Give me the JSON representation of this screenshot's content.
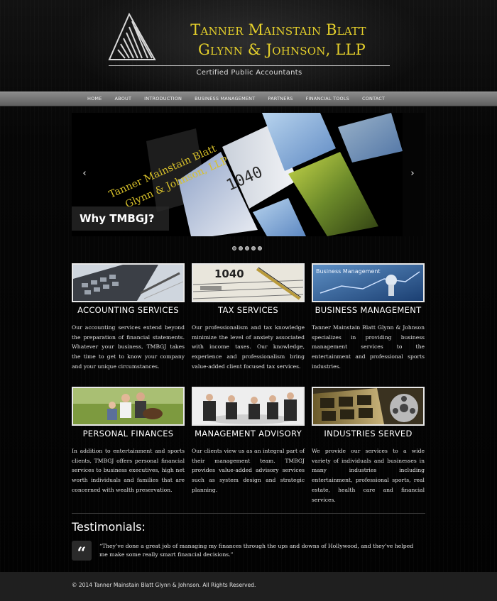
{
  "header": {
    "firm_name_line1": "Tanner Mainstain Blatt",
    "firm_name_line2": "Glynn & Johnson, LLP",
    "tagline": "Certified Public Accountants"
  },
  "nav": {
    "items": [
      "HOME",
      "ABOUT",
      "INTRODUCTION",
      "BUSINESS MANAGEMENT",
      "PARTNERS",
      "FINANCIAL TOOLS",
      "CONTACT"
    ]
  },
  "slider": {
    "caption": "Why TMBGJ?",
    "overlay_line1": "Tanner Mainstain Blatt",
    "overlay_line2": "Glynn & Johnson, LLP",
    "prev_icon": "‹",
    "next_icon": "›",
    "dot_count": 5,
    "active_dot": 0
  },
  "services": [
    {
      "title": "ACCOUNTING SERVICES",
      "text": "Our accounting services extend beyond the preparation of financial statements. Whatever your business, TMBGJ takes the time to get to know your company and your unique circumstances.",
      "image": "calculator-photo"
    },
    {
      "title": "TAX SERVICES",
      "text": "Our professionalism and tax knowledge minimize the level of anxiety associated with income taxes. Our knowledge, experience and professionalism bring value-added client focused tax services.",
      "image": "tax-form-photo",
      "image_text": "1040"
    },
    {
      "title": "BUSINESS MANAGEMENT",
      "text": "Tanner Mainstain Blatt Glynn & Johnson specializes in providing business management services to the entertainment and professional sports industries.",
      "image": "business-chart-photo",
      "image_text": "Business Management"
    },
    {
      "title": "PERSONAL FINANCES",
      "text": "In addition to entertainment and sports clients, TMBGJ offers personal financial services to business executives, high net worth individuals and families that are concerned with wealth preservation.",
      "image": "family-photo"
    },
    {
      "title": "MANAGEMENT ADVISORY",
      "text": "Our clients view us as an integral part of their management team. TMBGJ provides value-added advisory services such as system design and strategic planning.",
      "image": "meeting-photo"
    },
    {
      "title": "INDUSTRIES SERVED",
      "text": "We provide our services to a wide variety of individuals and businesses in many industries including entertainment, professional sports, real estate, health care and financial services.",
      "image": "film-reel-photo"
    }
  ],
  "testimonials": {
    "heading": "Testimonials:",
    "quote_icon": "“",
    "quote": "“They’ve done a great job of managing my finances through the ups and downs of Hollywood, and they’ve helped me make some really smart financial decisions.”"
  },
  "footer": {
    "copyright": "© 2014 Tanner Mainstain Blatt Glynn & Johnson. All Rights Reserved."
  },
  "colors": {
    "brand_gold": "#e4cf2b",
    "background": "#050505",
    "nav_bar": "#7a7a7a",
    "footer": "#1f1f1f"
  }
}
